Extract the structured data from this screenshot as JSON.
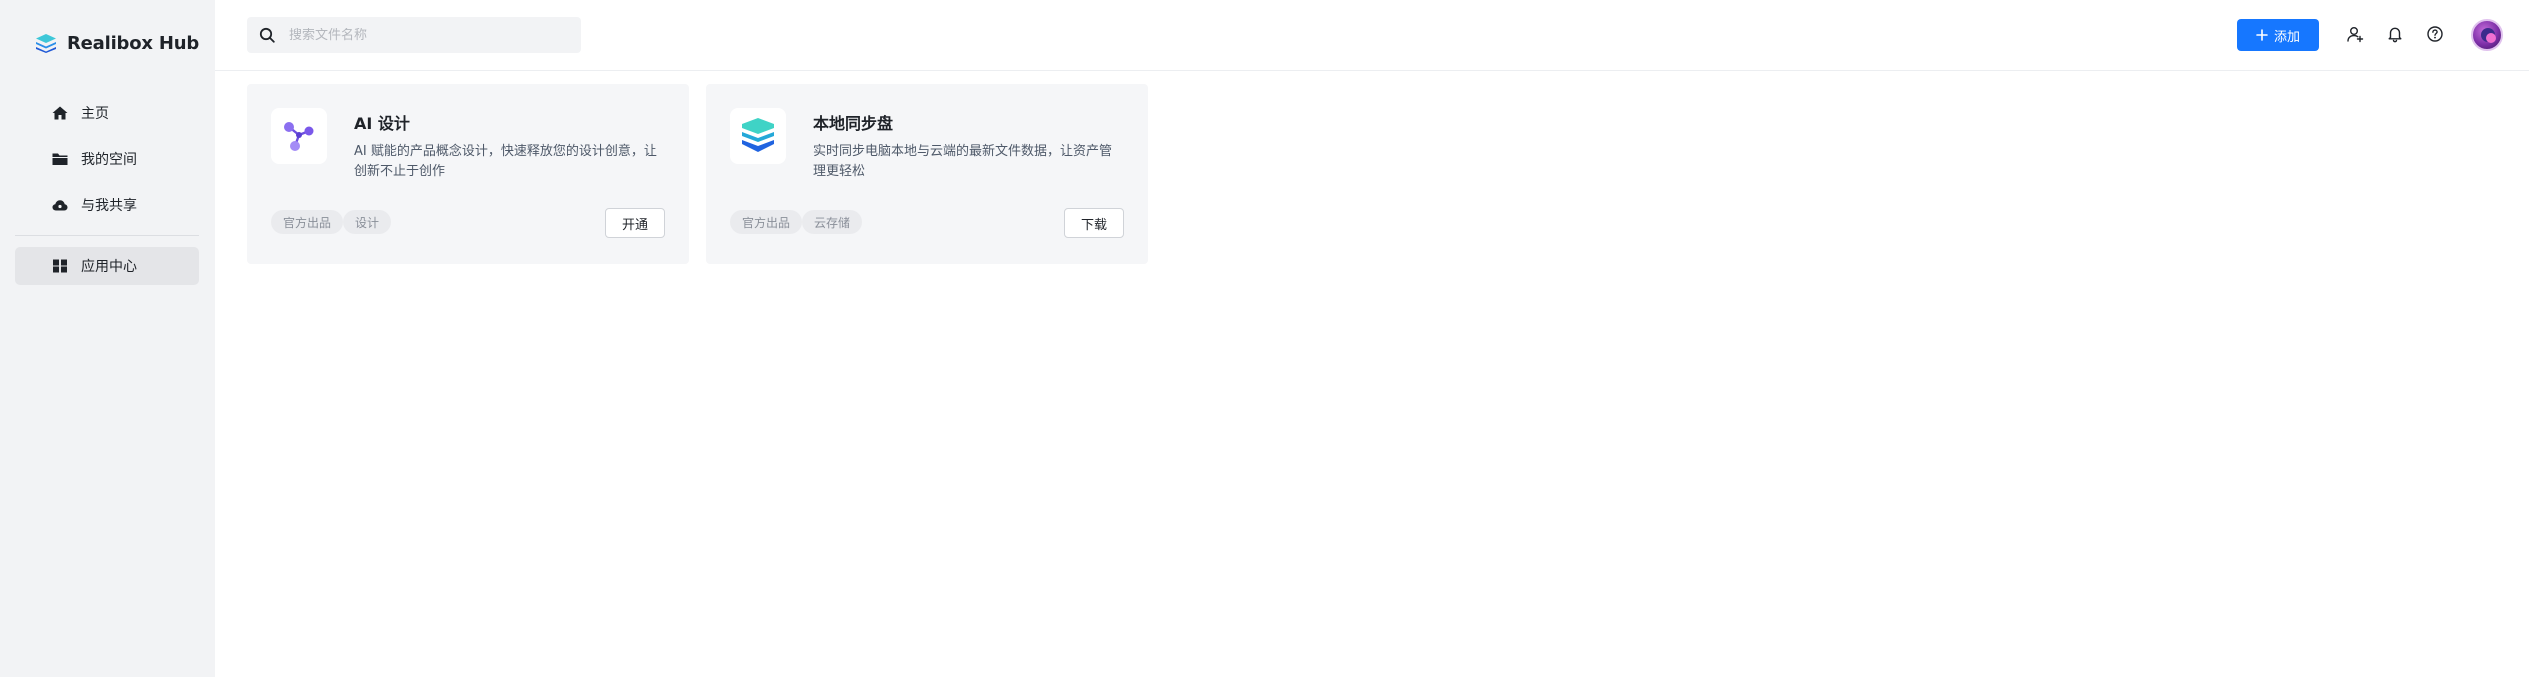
{
  "app": {
    "name": "Realibox Hub"
  },
  "sidebar": {
    "items": [
      {
        "label": "主页",
        "icon": "home-icon"
      },
      {
        "label": "我的空间",
        "icon": "folder-icon"
      },
      {
        "label": "与我共享",
        "icon": "cloud-share-icon"
      },
      {
        "label": "应用中心",
        "icon": "grid-apps-icon",
        "active": true
      }
    ]
  },
  "header": {
    "search": {
      "placeholder": "搜索文件名称",
      "value": ""
    },
    "add_label": "添加",
    "accent": "#1677ff",
    "icons": [
      "user-add-icon",
      "bell-icon",
      "help-icon"
    ]
  },
  "apps": [
    {
      "title": "AI 设计",
      "description": "AI 赋能的产品概念设计，快速释放您的设计创意，让创新不止于创作",
      "tags": [
        "官方出品",
        "设计"
      ],
      "action": "开通",
      "icon": "ai-design-icon"
    },
    {
      "title": "本地同步盘",
      "description": "实时同步电脑本地与云端的最新文件数据，让资产管理更轻松",
      "tags": [
        "官方出品",
        "云存储"
      ],
      "action": "下载",
      "icon": "sync-drive-icon"
    }
  ]
}
